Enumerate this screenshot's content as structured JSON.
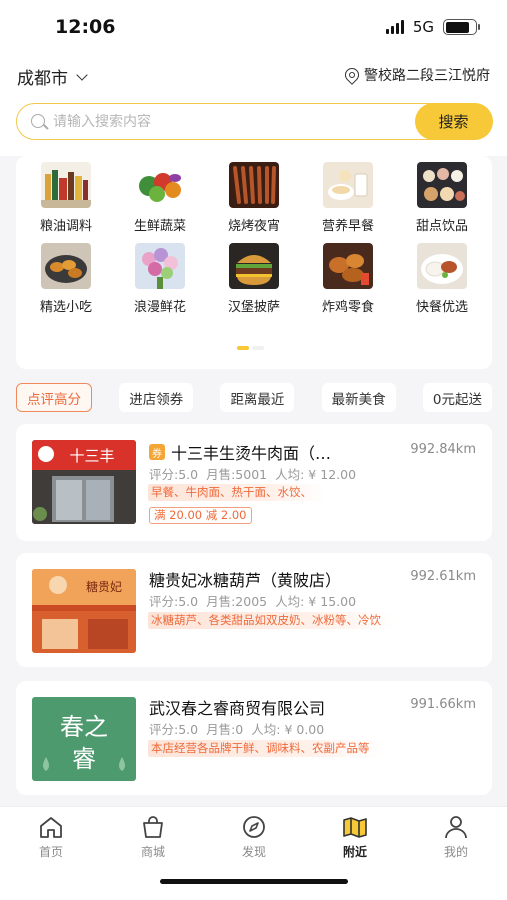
{
  "status_bar": {
    "time": "12:06",
    "network": "5G"
  },
  "header": {
    "city": "成都市",
    "location": "警校路二段三江悦府"
  },
  "search": {
    "placeholder": "请输入搜索内容",
    "button_label": "搜索"
  },
  "categories": [
    {
      "label": "粮油调料"
    },
    {
      "label": "生鲜蔬菜"
    },
    {
      "label": "烧烤夜宵"
    },
    {
      "label": "营养早餐"
    },
    {
      "label": "甜点饮品"
    },
    {
      "label": "精选小吃"
    },
    {
      "label": "浪漫鲜花"
    },
    {
      "label": "汉堡披萨"
    },
    {
      "label": "炸鸡零食"
    },
    {
      "label": "快餐优选"
    }
  ],
  "filters": [
    "点评高分",
    "进店领券",
    "距离最近",
    "最新美食",
    "0元起送"
  ],
  "shops": [
    {
      "badge": "券",
      "title": "十三丰生烫牛肉面（…",
      "distance": "992.84km",
      "rating": "评分:5.0",
      "sales": "月售:5001",
      "avg": "人均: ¥ 12.00",
      "tags": "早餐、牛肉面、热干面、水饺、",
      "promo": "满 20.00 减 2.00",
      "sign_text": "十三丰"
    },
    {
      "title": "糖贵妃冰糖葫芦（黄陂店）",
      "distance": "992.61km",
      "rating": "评分:5.0",
      "sales": "月售:2005",
      "avg": "人均: ¥ 15.00",
      "tags": "冰糖葫芦、各类甜品如双皮奶、冰粉等、冷饮",
      "sign_text": "糖贵妃"
    },
    {
      "title": "武汉春之睿商贸有限公司",
      "distance": "991.66km",
      "rating": "评分:5.0",
      "sales": "月售:0",
      "avg": "人均: ¥ 0.00",
      "tags": "本店经营各品牌干鲜、调味料、农副产品等",
      "sign_line1": "春之",
      "sign_line2": "睿"
    }
  ],
  "tabbar": [
    {
      "label": "首页",
      "icon": "home-icon"
    },
    {
      "label": "商城",
      "icon": "shopping-bag-icon"
    },
    {
      "label": "发现",
      "icon": "compass-icon"
    },
    {
      "label": "附近",
      "icon": "map-icon",
      "active": true
    },
    {
      "label": "我的",
      "icon": "user-icon"
    }
  ],
  "colors": {
    "accent": "#f7c837",
    "tag_orange": "#ef6a3b",
    "active_chip": "#ec6a3c"
  }
}
